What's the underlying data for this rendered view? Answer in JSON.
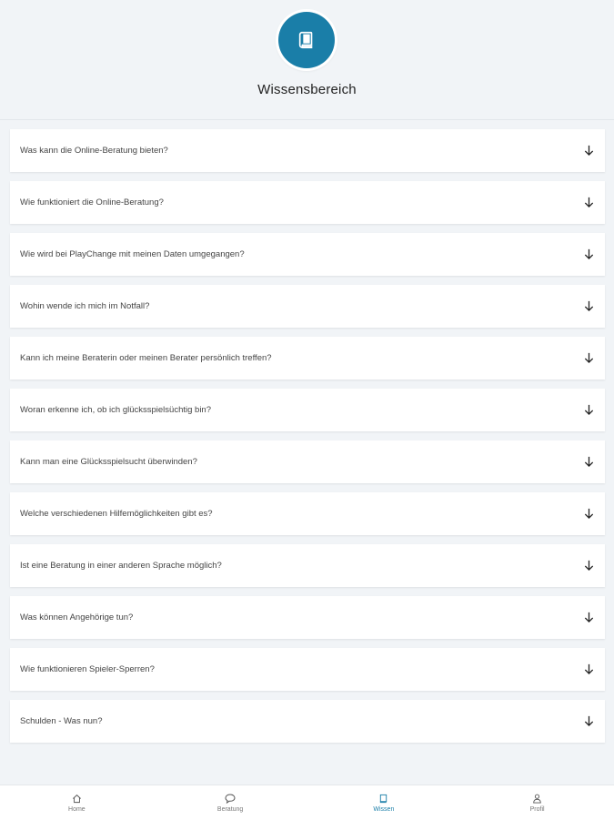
{
  "header": {
    "title": "Wissensbereich",
    "icon": "book-icon",
    "accent_color": "#1a7ea8"
  },
  "faq": [
    {
      "question": "Was kann die Online-Beratung bieten?"
    },
    {
      "question": "Wie funktioniert die Online-Beratung?"
    },
    {
      "question": "Wie wird bei PlayChange mit meinen Daten umgegangen?"
    },
    {
      "question": "Wohin wende ich mich im Notfall?"
    },
    {
      "question": "Kann ich meine Beraterin oder meinen Berater persönlich treffen?"
    },
    {
      "question": "Woran erkenne ich, ob ich glücksspielsüchtig bin?"
    },
    {
      "question": "Kann man eine Glücksspielsucht überwinden?"
    },
    {
      "question": "Welche verschiedenen Hilfemöglichkeiten gibt es?"
    },
    {
      "question": "Ist eine Beratung in einer anderen Sprache möglich?"
    },
    {
      "question": "Was können Angehörige tun?"
    },
    {
      "question": "Wie funktionieren Spieler-Sperren?"
    },
    {
      "question": "Schulden - Was nun?"
    }
  ],
  "nav": {
    "items": [
      {
        "label": "Home",
        "icon": "home-icon"
      },
      {
        "label": "Beratung",
        "icon": "chat-bubble-icon"
      },
      {
        "label": "Wissen",
        "icon": "book-icon",
        "active": true
      },
      {
        "label": "Profil",
        "icon": "user-icon"
      }
    ]
  }
}
